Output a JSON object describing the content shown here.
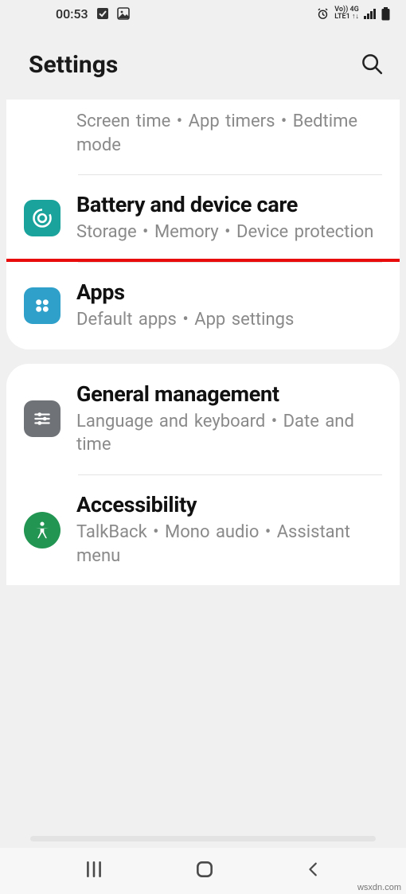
{
  "statusbar": {
    "time": "00:53",
    "lte_top": "Vo)) 4G",
    "lte_bottom": "LTE1 ↑↓"
  },
  "header": {
    "title": "Settings"
  },
  "card1": {
    "items": [
      {
        "title": "",
        "subtitle": "Screen time  •  App timers  •  Bedtime mode"
      },
      {
        "title": "Battery and device care",
        "subtitle": "Storage  •  Memory  •  Device protection"
      },
      {
        "title": "Apps",
        "subtitle": "Default apps  •  App settings"
      }
    ]
  },
  "card2": {
    "items": [
      {
        "title": "General management",
        "subtitle": "Language and keyboard  •  Date and time"
      },
      {
        "title": "Accessibility",
        "subtitle": "TalkBack  •  Mono audio  •  Assistant menu"
      }
    ]
  },
  "watermark": "wsxdn.com"
}
